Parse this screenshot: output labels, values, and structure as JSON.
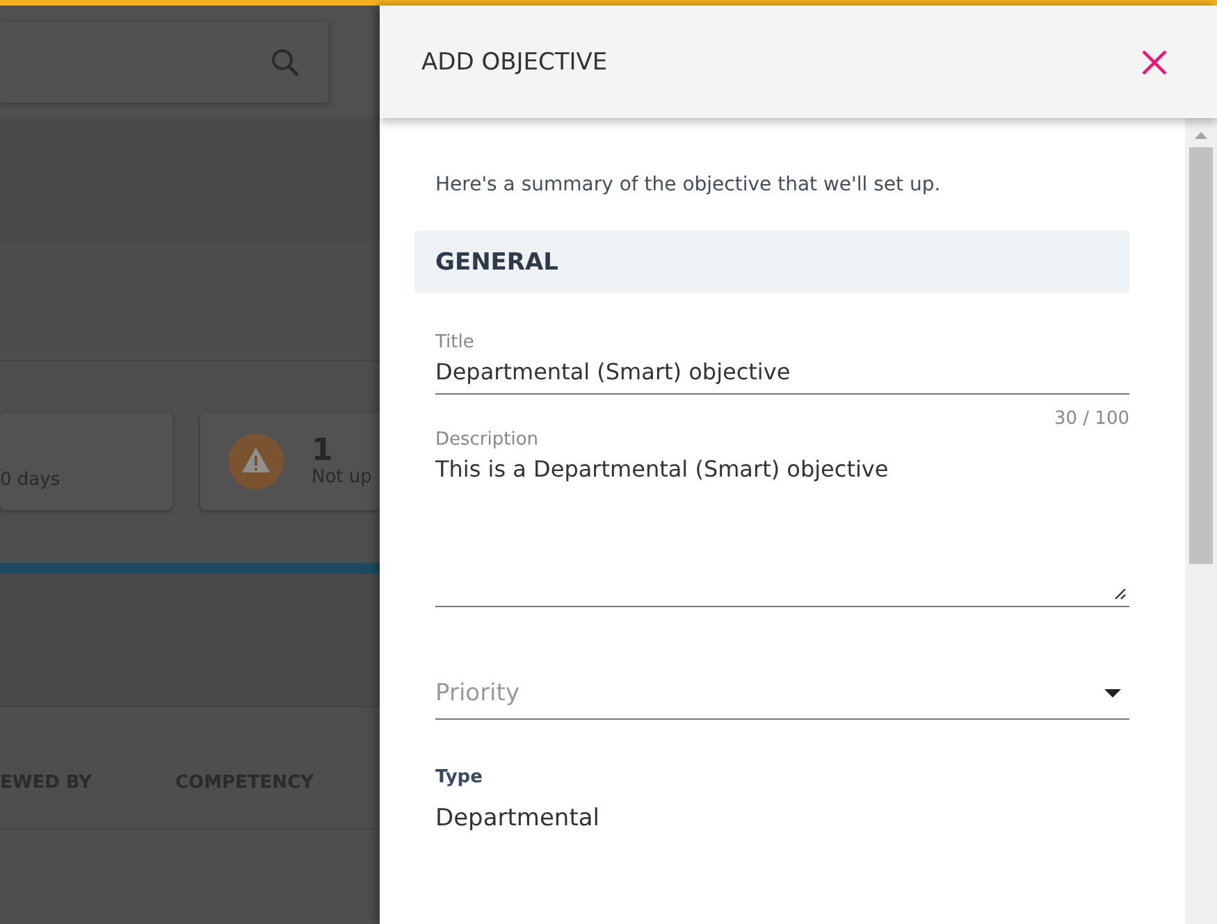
{
  "background": {
    "stat_cards": [
      {
        "kind": "plain",
        "label": "0 days"
      },
      {
        "kind": "warning",
        "count": "1",
        "label": "Not up"
      }
    ],
    "table_columns": [
      "EWED BY",
      "COMPETENCY"
    ]
  },
  "panel": {
    "title": "ADD OBJECTIVE",
    "intro": "Here's a summary of the objective that we'll set up.",
    "section": "GENERAL",
    "fields": [
      {
        "kind": "text",
        "label": "Title",
        "value": "Departmental (Smart) objective",
        "counter": "30 / 100"
      },
      {
        "kind": "textarea",
        "label": "Description",
        "value": "This is a Departmental (Smart) objective"
      },
      {
        "kind": "select",
        "placeholder": "Priority"
      },
      {
        "kind": "static",
        "label": "Type",
        "value": "Departmental"
      }
    ]
  }
}
